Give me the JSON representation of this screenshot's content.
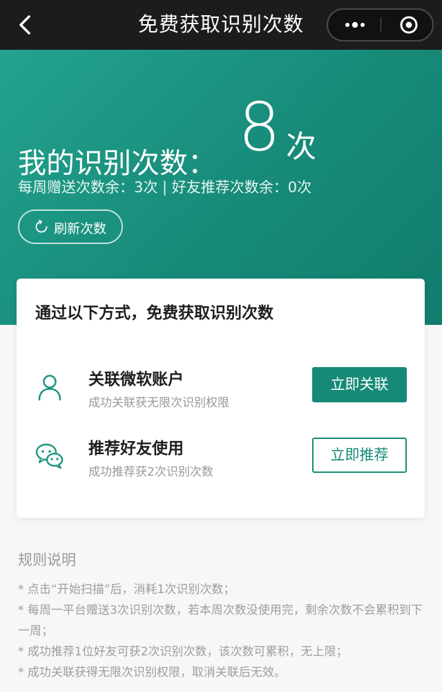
{
  "navbar": {
    "title": "免费获取识别次数",
    "back_icon": "chevron-left-icon",
    "more_icon": "more-dots-icon",
    "close_icon": "target-close-icon"
  },
  "hero": {
    "label": "我的识别次数：",
    "count": "8",
    "unit": "次",
    "subtitle": "每周赠送次数余：3次 | 好友推荐次数余：0次",
    "refresh_label": "刷新次数",
    "refresh_icon": "refresh-icon",
    "accent_color": "#1a9480"
  },
  "card": {
    "title": "通过以下方式，免费获取识别次数",
    "methods": [
      {
        "icon": "user-icon",
        "name": "关联微软账户",
        "desc": "成功关联获无限次识别权限",
        "action": "立即关联"
      },
      {
        "icon": "wechat-icon",
        "name": "推荐好友使用",
        "desc": "成功推荐获2次识别次数",
        "action": "立即推荐"
      }
    ]
  },
  "rules": {
    "title": "规则说明",
    "items": [
      "* 点击“开始扫描”后，消耗1次识别次数；",
      "* 每周一平台赠送3次识别次数，若本周次数没使用完，剩余次数不会累积到下一周；",
      "* 成功推荐1位好友可获2次识别次数，该次数可累积，无上限；",
      "* 成功关联获得无限次识别权限，取消关联后无效。"
    ]
  }
}
